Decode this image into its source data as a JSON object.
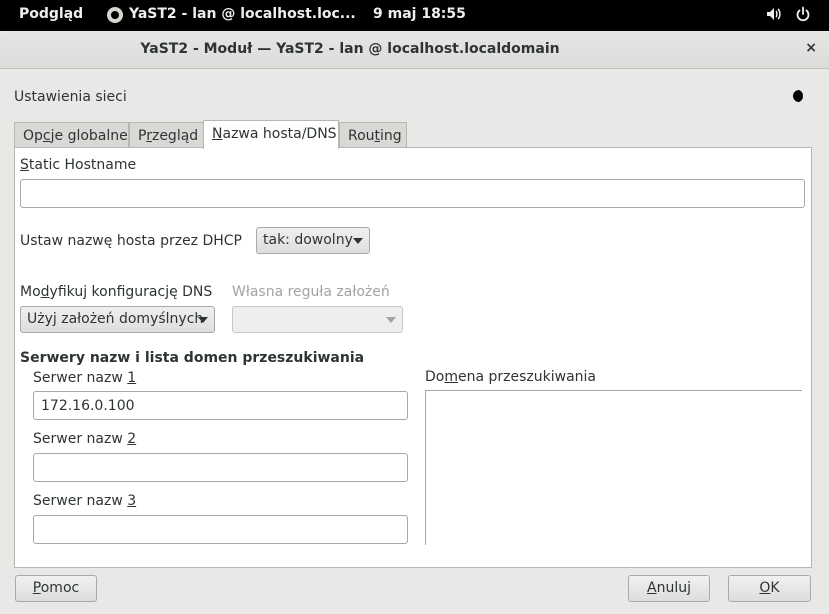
{
  "topbar": {
    "activities": "Podgląd",
    "app": "YaST2 - lan @ localhost.loc...",
    "clock": "9 maj  18:55"
  },
  "window": {
    "title": "YaST2 - Moduł — YaST2 - lan @ localhost.localdomain",
    "close": "×"
  },
  "section": {
    "title": "Ustawienia sieci"
  },
  "tabs": [
    {
      "label": "Opcje globalne",
      "pre": "Op",
      "ul": "c",
      "post": "je globalne"
    },
    {
      "label": "Przegląd",
      "pre": "P",
      "ul": "r",
      "post": "zegląd"
    },
    {
      "label": "Nazwa hosta/DNS",
      "pre": "",
      "ul": "N",
      "post": "azwa hosta/DNS"
    },
    {
      "label": "Routing",
      "pre": "Rou",
      "ul": "t",
      "post": "ing"
    }
  ],
  "form": {
    "static_hostname_label": {
      "pre": "",
      "ul": "S",
      "post": "tatic Hostname"
    },
    "static_hostname_value": "",
    "dhcp_label": "Ustaw nazwę hosta przez DHCP",
    "dhcp_value": "tak: dowolny",
    "dns_mod_label": {
      "pre": "Mo",
      "ul": "d",
      "post": "yfikuj konfigurację DNS"
    },
    "dns_mod_value": "Użyj założeń domyślnych",
    "custom_rule_label": "Własna reguła założeń",
    "custom_rule_value": "",
    "servers_heading": "Serwery nazw i lista domen przeszukiwania",
    "ns1_label": {
      "pre": "Serwer nazw ",
      "ul": "1",
      "post": ""
    },
    "ns1_value": "172.16.0.100",
    "ns2_label": {
      "pre": "Serwer nazw ",
      "ul": "2",
      "post": ""
    },
    "ns2_value": "",
    "ns3_label": {
      "pre": "Serwer nazw ",
      "ul": "3",
      "post": ""
    },
    "ns3_value": "",
    "search_domain_label": {
      "pre": "Do",
      "ul": "m",
      "post": "ena przeszukiwania"
    }
  },
  "buttons": {
    "help": {
      "pre": "",
      "ul": "P",
      "post": "omoc"
    },
    "cancel": {
      "pre": "",
      "ul": "A",
      "post": "nuluj"
    },
    "ok": {
      "pre": "",
      "ul": "O",
      "post": "K"
    }
  }
}
